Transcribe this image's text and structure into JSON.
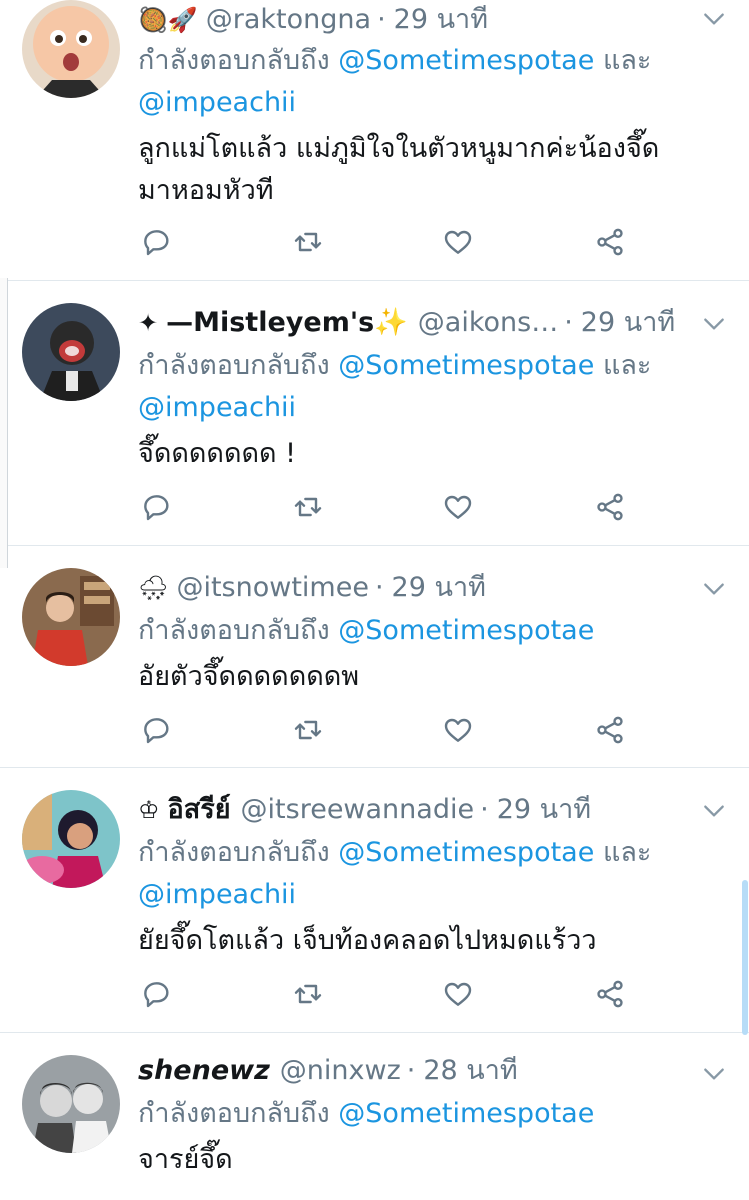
{
  "colors": {
    "mention": "#1b95e0",
    "secondary": "#657786",
    "text": "#14171a",
    "divider": "#e1e8ed"
  },
  "tweets": [
    {
      "emoji": "🥘🚀",
      "display_name": "",
      "handle": "@raktongna",
      "sep": "·",
      "time": "29 นาที",
      "reply_label": "กำลังตอบกลับถึง",
      "mention1": "@Sometimespotae",
      "and": "และ",
      "mention2": "@impeachii",
      "text_line1": "ลูกแม่โตแล้ว แม่ภูมิใจในตัวหนูมากค่ะน้องจึ๊ด",
      "text_line2": "มาหอมหัวที",
      "avatar_icon": "boss-baby-avatar"
    },
    {
      "emoji": "✦",
      "display_name": "—Mistleyem's✨",
      "handle": "@aikons…",
      "sep": "·",
      "time": "29 นาที",
      "reply_label": "กำลังตอบกลับถึง",
      "mention1": "@Sometimespotae",
      "and": "และ",
      "mention2": "@impeachii",
      "text_line1": "จึ๊ดดดดดดด !",
      "avatar_icon": "masked-person-avatar"
    },
    {
      "emoji": "🌨",
      "display_name": "",
      "handle": "@itsnowtimee",
      "sep": "·",
      "time": "29 นาที",
      "reply_label": "กำลังตอบกลับถึง",
      "mention1": "@Sometimespotae",
      "text_line1": "อัยตัวจึ๊ดดดดดดดพ",
      "avatar_icon": "person-red-shirt-avatar"
    },
    {
      "emoji": "♔",
      "display_name": "อิสรีย์",
      "handle": "@itsreewannadie",
      "sep": "·",
      "time": "29 นาที",
      "reply_label": "กำลังตอบกลับถึง",
      "mention1": "@Sometimespotae",
      "and": "และ",
      "mention2": "@impeachii",
      "text_line1": "ยัยจึ๊ดโตแล้ว เจ็บท้องคลอดไปหมดแร้วว",
      "avatar_icon": "cartoon-girl-avatar"
    },
    {
      "emoji": "",
      "display_name": "shenewz",
      "handle": "@ninxwz",
      "sep": "·",
      "time": "28 นาที",
      "reply_label": "กำลังตอบกลับถึง",
      "mention1": "@Sometimespotae",
      "text_line1": "จารย์จึ๊ด",
      "avatar_icon": "two-people-bw-avatar"
    }
  ]
}
